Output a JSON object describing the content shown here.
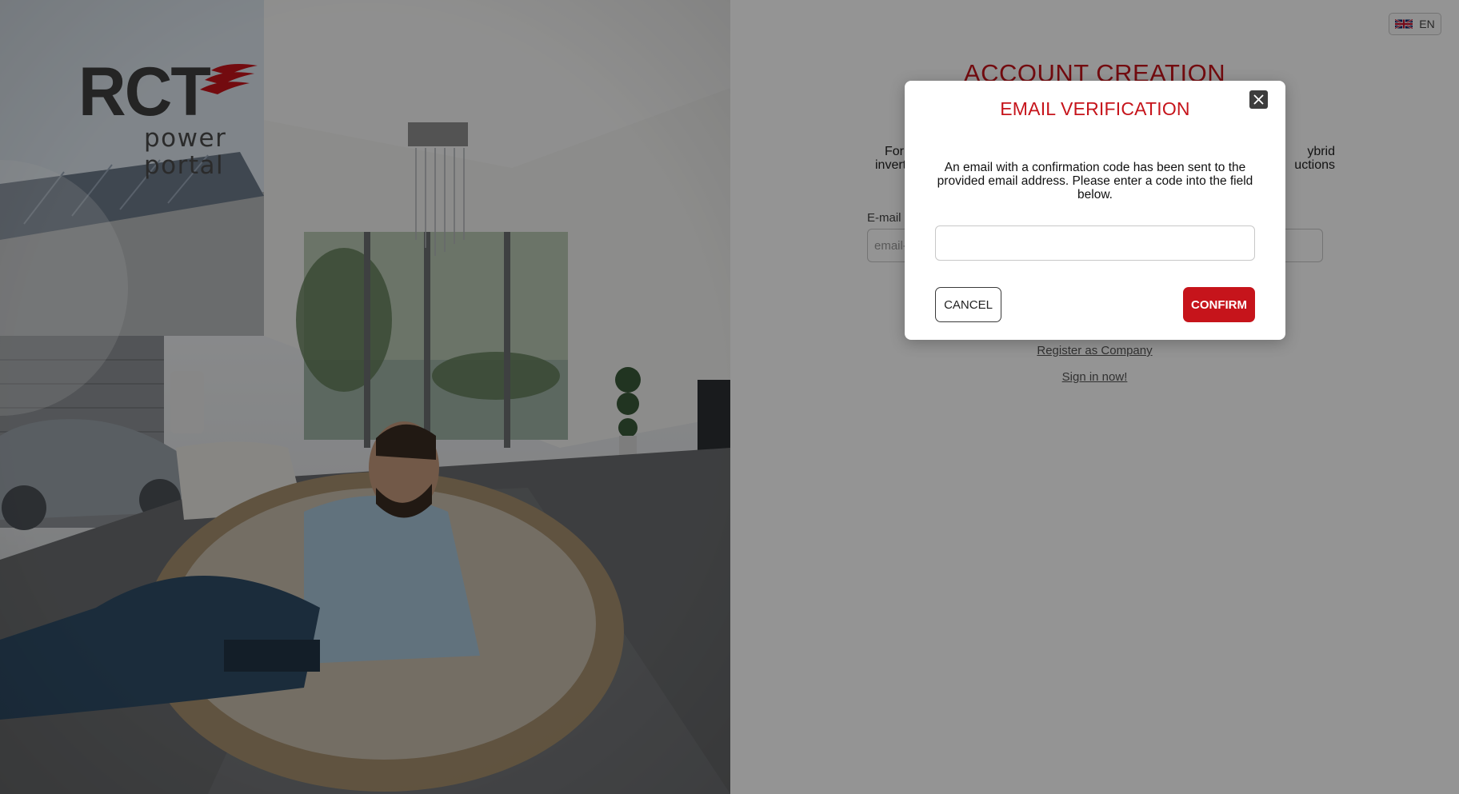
{
  "brand": {
    "logo_text": "RCT",
    "tagline_line1": "power",
    "tagline_line2": "portal"
  },
  "header": {
    "language_label": "EN",
    "language_flag_icon": "uk-flag-icon"
  },
  "form": {
    "title": "ACCOUNT CREATION",
    "intro_left": "For",
    "intro_left2": "inverte",
    "intro_right": "ybrid",
    "intro_right2": "uctions",
    "email_label": "E-mail",
    "email_required_mark": "*",
    "email_placeholder": "email-(",
    "register_company_link": "Register as Company",
    "sign_in_link": "Sign in now!"
  },
  "modal": {
    "title": "EMAIL VERIFICATION",
    "message": "An email with a confirmation code has been sent to the provided email address. Please enter a code into the field below.",
    "code_value": "",
    "cancel_label": "CANCEL",
    "confirm_label": "CONFIRM",
    "close_icon": "close-icon"
  },
  "colors": {
    "accent": "#c6141b",
    "overlay": "rgba(0,0,0,0.42)",
    "text_dark": "#111111"
  }
}
